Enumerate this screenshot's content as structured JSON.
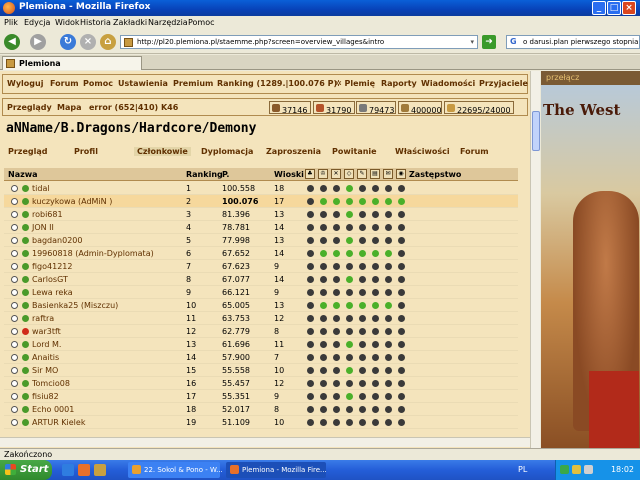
{
  "window": {
    "title": "Plemiona - Mozilla Firefox"
  },
  "menubar": [
    "Plik",
    "Edycja",
    "Widok",
    "Historia",
    "Zakładki",
    "Narzędzia",
    "Pomoc"
  ],
  "navigation": {
    "url": "http://pl20.plemiona.pl/staemme.php?screen=overview_villages&intro",
    "search_value": "o darusi.plan pierwszego stopnia"
  },
  "browser_tab": {
    "label": "Plemiona"
  },
  "game_menu": [
    "Wyloguj",
    "Forum",
    "Pomoc",
    "Ustawienia",
    "Premium",
    "Ranking (1289.|100.076 P)",
    "✲ Plemię",
    "Raporty",
    "Wiadomości",
    "Przyjaciele"
  ],
  "village_bar": {
    "overview": "Przeglądy",
    "map": "Mapa",
    "village": "error (652|410) K46",
    "wood": "37146",
    "clay": "31790",
    "iron": "79473",
    "storage": "400000",
    "population": "22695/24000"
  },
  "tribe": {
    "name": "aNName/B.Dragons/Hardcore/Demony",
    "tabs": [
      "Przegląd",
      "Profil",
      "Członkowie",
      "Dyplomacja",
      "Zaproszenia",
      "Powitanie",
      "Właściwości",
      "Forum"
    ],
    "selected_tab": "Członkowie"
  },
  "members": {
    "headers": {
      "name": "Nazwa",
      "rank": "Ranking",
      "points": "P.",
      "villages": "Wioski",
      "deputy": "Zastępstwo"
    },
    "rows": [
      {
        "name": "tidal",
        "rank": "1",
        "points": "100.558",
        "villages": "18",
        "status": "#4a9a2a",
        "dots": [
          "#3a3a3a",
          "#3a3a3a",
          "#3a3a3a",
          "#4ab02a",
          "#3a3a3a",
          "#3a3a3a",
          "#3a3a3a",
          "#3a3a3a"
        ]
      },
      {
        "name": "kuczykowa (AdMiN )",
        "rank": "2",
        "points": "100.076",
        "villages": "17",
        "status": "#4a9a2a",
        "highlight": true,
        "dots": [
          "#3a3a3a",
          "#4ab02a",
          "#4ab02a",
          "#4ab02a",
          "#4ab02a",
          "#4ab02a",
          "#4ab02a",
          "#4ab02a"
        ]
      },
      {
        "name": "robi681",
        "rank": "3",
        "points": "81.396",
        "villages": "13",
        "status": "#4a9a2a",
        "dots": [
          "#3a3a3a",
          "#3a3a3a",
          "#3a3a3a",
          "#4ab02a",
          "#3a3a3a",
          "#3a3a3a",
          "#3a3a3a",
          "#3a3a3a"
        ]
      },
      {
        "name": "JON II",
        "rank": "4",
        "points": "78.781",
        "villages": "14",
        "status": "#4a9a2a",
        "dots": [
          "#3a3a3a",
          "#3a3a3a",
          "#3a3a3a",
          "#3a3a3a",
          "#3a3a3a",
          "#3a3a3a",
          "#3a3a3a",
          "#3a3a3a"
        ]
      },
      {
        "name": "bagdan0200",
        "rank": "5",
        "points": "77.998",
        "villages": "13",
        "status": "#4a9a2a",
        "dots": [
          "#3a3a3a",
          "#3a3a3a",
          "#3a3a3a",
          "#4ab02a",
          "#3a3a3a",
          "#3a3a3a",
          "#3a3a3a",
          "#3a3a3a"
        ]
      },
      {
        "name": "19960818 (Admin-Dyplomata)",
        "rank": "6",
        "points": "67.652",
        "villages": "14",
        "status": "#4a9a2a",
        "dots": [
          "#3a3a3a",
          "#4ab02a",
          "#4ab02a",
          "#4ab02a",
          "#4ab02a",
          "#4ab02a",
          "#4ab02a",
          "#3a3a3a"
        ]
      },
      {
        "name": "figo41212",
        "rank": "7",
        "points": "67.623",
        "villages": "9",
        "status": "#4a9a2a",
        "dots": [
          "#3a3a3a",
          "#3a3a3a",
          "#3a3a3a",
          "#3a3a3a",
          "#3a3a3a",
          "#3a3a3a",
          "#3a3a3a",
          "#3a3a3a"
        ]
      },
      {
        "name": "CarlosGT",
        "rank": "8",
        "points": "67.077",
        "villages": "14",
        "status": "#4a9a2a",
        "dots": [
          "#3a3a3a",
          "#3a3a3a",
          "#3a3a3a",
          "#4ab02a",
          "#3a3a3a",
          "#3a3a3a",
          "#3a3a3a",
          "#3a3a3a"
        ]
      },
      {
        "name": "Lewa reka",
        "rank": "9",
        "points": "66.121",
        "villages": "9",
        "status": "#4a9a2a",
        "dots": [
          "#3a3a3a",
          "#3a3a3a",
          "#3a3a3a",
          "#3a3a3a",
          "#3a3a3a",
          "#3a3a3a",
          "#3a3a3a",
          "#3a3a3a"
        ]
      },
      {
        "name": "Basienka25 (Miszczu)",
        "rank": "10",
        "points": "65.005",
        "villages": "13",
        "status": "#4a9a2a",
        "dots": [
          "#3a3a3a",
          "#4ab02a",
          "#4ab02a",
          "#4ab02a",
          "#4ab02a",
          "#4ab02a",
          "#4ab02a",
          "#3a3a3a"
        ]
      },
      {
        "name": "raftra",
        "rank": "11",
        "points": "63.753",
        "villages": "12",
        "status": "#4a9a2a",
        "dots": [
          "#3a3a3a",
          "#3a3a3a",
          "#3a3a3a",
          "#3a3a3a",
          "#3a3a3a",
          "#3a3a3a",
          "#3a3a3a",
          "#3a3a3a"
        ]
      },
      {
        "name": "war3tft",
        "rank": "12",
        "points": "62.779",
        "villages": "8",
        "status": "#d02a1a",
        "dots": [
          "#3a3a3a",
          "#3a3a3a",
          "#3a3a3a",
          "#3a3a3a",
          "#3a3a3a",
          "#3a3a3a",
          "#3a3a3a",
          "#3a3a3a"
        ]
      },
      {
        "name": "Lord M.",
        "rank": "13",
        "points": "61.696",
        "villages": "11",
        "status": "#4a9a2a",
        "dots": [
          "#3a3a3a",
          "#3a3a3a",
          "#3a3a3a",
          "#4ab02a",
          "#3a3a3a",
          "#3a3a3a",
          "#3a3a3a",
          "#3a3a3a"
        ]
      },
      {
        "name": "Anaitis",
        "rank": "14",
        "points": "57.900",
        "villages": "7",
        "status": "#4a9a2a",
        "dots": [
          "#3a3a3a",
          "#3a3a3a",
          "#3a3a3a",
          "#3a3a3a",
          "#3a3a3a",
          "#3a3a3a",
          "#3a3a3a",
          "#3a3a3a"
        ]
      },
      {
        "name": "Sir MO",
        "rank": "15",
        "points": "55.558",
        "villages": "10",
        "status": "#4a9a2a",
        "dots": [
          "#3a3a3a",
          "#3a3a3a",
          "#3a3a3a",
          "#4ab02a",
          "#3a3a3a",
          "#3a3a3a",
          "#3a3a3a",
          "#3a3a3a"
        ]
      },
      {
        "name": "Tomcio08",
        "rank": "16",
        "points": "55.457",
        "villages": "12",
        "status": "#4a9a2a",
        "dots": [
          "#3a3a3a",
          "#3a3a3a",
          "#3a3a3a",
          "#3a3a3a",
          "#3a3a3a",
          "#3a3a3a",
          "#3a3a3a",
          "#3a3a3a"
        ]
      },
      {
        "name": "fisiu82",
        "rank": "17",
        "points": "55.351",
        "villages": "9",
        "status": "#4a9a2a",
        "dots": [
          "#3a3a3a",
          "#3a3a3a",
          "#3a3a3a",
          "#4ab02a",
          "#3a3a3a",
          "#3a3a3a",
          "#3a3a3a",
          "#3a3a3a"
        ]
      },
      {
        "name": "Echo 0001",
        "rank": "18",
        "points": "52.017",
        "villages": "8",
        "status": "#4a9a2a",
        "dots": [
          "#3a3a3a",
          "#3a3a3a",
          "#3a3a3a",
          "#3a3a3a",
          "#3a3a3a",
          "#3a3a3a",
          "#3a3a3a",
          "#3a3a3a"
        ]
      },
      {
        "name": "ARTUR Kielek",
        "rank": "19",
        "points": "51.109",
        "villages": "10",
        "status": "#4a9a2a",
        "dots": [
          "#3a3a3a",
          "#3a3a3a",
          "#3a3a3a",
          "#3a3a3a",
          "#3a3a3a",
          "#3a3a3a",
          "#3a3a3a",
          "#3a3a3a"
        ]
      }
    ]
  },
  "banner": {
    "label": "przełącz",
    "title": "The West"
  },
  "status_bar": "Zakończono",
  "taskbar": {
    "start": "Start",
    "tasks": [
      "22. Sokol & Pono - W...",
      "Plemiona - Mozilla Fire..."
    ],
    "language": "PL",
    "time": "18:02"
  }
}
